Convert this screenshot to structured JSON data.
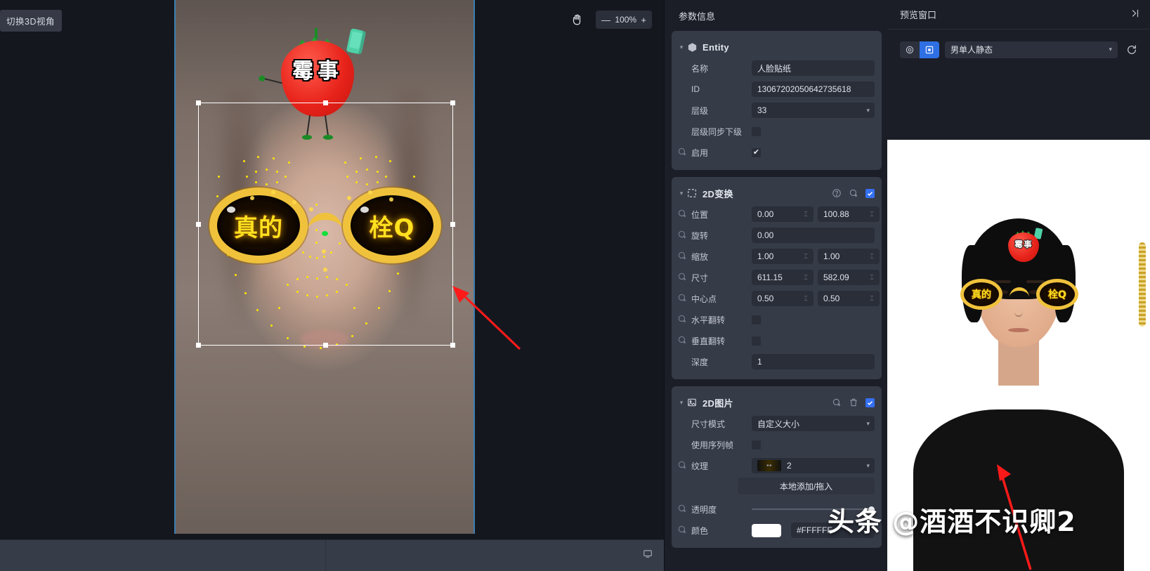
{
  "canvas": {
    "switch_3d_label": "切换3D视角",
    "hand_tool_name": "hand-pan-tool",
    "zoom": {
      "minus": "—",
      "value": "100%",
      "plus": "+"
    },
    "stickers": {
      "strawberry_text": "霉事",
      "glasses_left_text": "真的",
      "glasses_right_text": "栓Q"
    },
    "bottom_bar": {
      "left_label": "",
      "right_label": ""
    }
  },
  "param_panel": {
    "title": "参数信息",
    "entity": {
      "title": "Entity",
      "rows": {
        "name_label": "名称",
        "name_value": "人脸贴纸",
        "id_label": "ID",
        "id_value": "13067202050642735618",
        "layer_label": "层级",
        "layer_value": "33",
        "layer_sync_label": "层级同步下级",
        "enable_label": "启用"
      }
    },
    "transform2d": {
      "title": "2D变换",
      "rows": {
        "position_label": "位置",
        "position_x": "0.00",
        "position_y": "100.88",
        "rotation_label": "旋转",
        "rotation_value": "0.00",
        "scale_label": "缩放",
        "scale_x": "1.00",
        "scale_y": "1.00",
        "size_label": "尺寸",
        "size_x": "611.15",
        "size_y": "582.09",
        "anchor_label": "中心点",
        "anchor_x": "0.50",
        "anchor_y": "0.50",
        "flip_h_label": "水平翻转",
        "flip_v_label": "垂直翻转",
        "depth_label": "深度",
        "depth_value": "1"
      }
    },
    "image2d": {
      "title": "2D图片",
      "rows": {
        "size_mode_label": "尺寸模式",
        "size_mode_value": "自定义大小",
        "use_sequence_label": "使用序列帧",
        "texture_label": "纹理",
        "texture_value": "2",
        "local_add_label": "本地添加/拖入",
        "opacity_label": "透明度",
        "color_label": "颜色",
        "color_value": "#FFFFFF",
        "color_swatch": "#FFFFFF"
      }
    }
  },
  "preview": {
    "title": "预览窗口",
    "collapse_icon": "collapse-right-icon",
    "mode_camera_icon": "camera-mode-icon",
    "mode_image_icon": "image-mode-icon",
    "source_value": "男单人静态",
    "refresh_icon": "refresh-icon",
    "stickers": {
      "strawberry_text": "霉事",
      "glasses_left_text": "真的",
      "glasses_right_text": "栓Q"
    }
  },
  "watermark": {
    "text": "头条 @酒酒不识卿2"
  }
}
